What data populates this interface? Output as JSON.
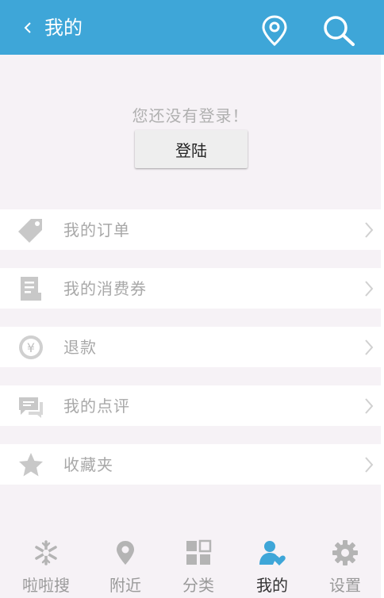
{
  "header": {
    "title": "我的",
    "back_icon": "chevron-left-icon",
    "location_icon": "location-pin-icon",
    "search_icon": "search-icon",
    "background": "#3ea6d8"
  },
  "login": {
    "prompt": "您还没有登录！",
    "button_label": "登陆"
  },
  "menu": {
    "items": [
      {
        "label": "我的订单",
        "icon": "tag-icon"
      },
      {
        "label": "我的消费券",
        "icon": "coupon-icon"
      },
      {
        "label": "退款",
        "icon": "yen-coin-icon"
      },
      {
        "label": "我的点评",
        "icon": "comment-icon"
      },
      {
        "label": "收藏夹",
        "icon": "star-icon"
      }
    ]
  },
  "tabbar": {
    "active_color": "#3ea6d8",
    "tabs": [
      {
        "label": "啦啦搜",
        "icon": "snowflake-icon",
        "active": false
      },
      {
        "label": "附近",
        "icon": "location-pin-icon",
        "active": false
      },
      {
        "label": "分类",
        "icon": "grid-icon",
        "active": false
      },
      {
        "label": "我的",
        "icon": "user-heart-icon",
        "active": true
      },
      {
        "label": "设置",
        "icon": "gear-icon",
        "active": false
      }
    ]
  }
}
